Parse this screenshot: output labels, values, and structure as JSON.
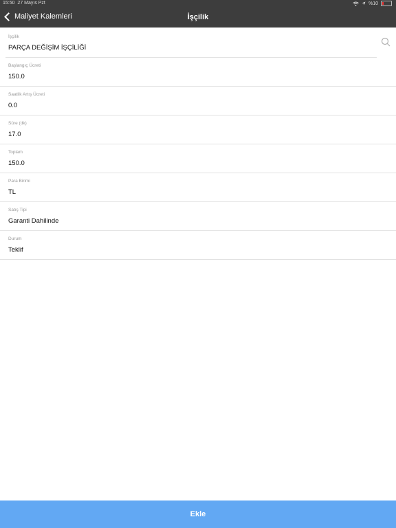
{
  "status": {
    "time": "15:50",
    "date": "27 Mayıs Pzt",
    "battery": "%10"
  },
  "nav": {
    "back_label": "Maliyet Kalemleri",
    "title": "İşçilik"
  },
  "fields": [
    {
      "label": "İşçilik",
      "value": "PARÇA DEĞİŞİM İŞÇİLİĞİ"
    },
    {
      "label": "Başlangıç Ücreti",
      "value": "150.0"
    },
    {
      "label": "Saatlik Artış Ücreti",
      "value": "0.0"
    },
    {
      "label": "Süre (dk)",
      "value": "17.0"
    },
    {
      "label": "Toplam",
      "value": "150.0"
    },
    {
      "label": "Para Birimi",
      "value": "TL"
    },
    {
      "label": "Satış Tipi",
      "value": "Garanti Dahilinde"
    },
    {
      "label": "Durum",
      "value": "Teklif"
    }
  ],
  "footer": {
    "add_label": "Ekle"
  },
  "colors": {
    "topbar": "#3d3d3d",
    "accent": "#62a8f3"
  }
}
